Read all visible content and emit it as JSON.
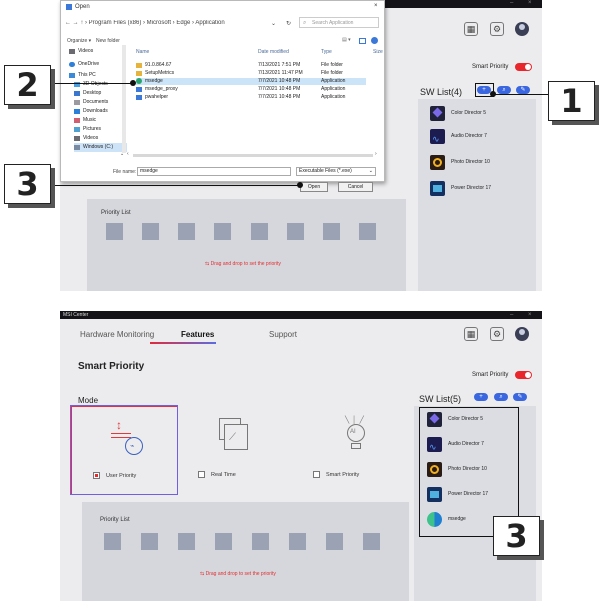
{
  "panel1": {
    "window_controls": {
      "min": "–",
      "close": "×"
    },
    "smart_priority_label": "Smart Priority",
    "sw_list_title": "SW List(4)",
    "apps": [
      "Color Director 5",
      "Audio Director 7",
      "Photo Director 10",
      "Power Director 17"
    ],
    "priority_list_title": "Priority List",
    "drag_hint": "Drag and drop to set the priority",
    "dialog": {
      "title": "Open",
      "path": "← → ↑  ›  Program Files (x86)  ›  Microsoft  ›  Edge  ›  Application",
      "search_placeholder": "Search Application",
      "organize": "Organize ▾",
      "new_folder": "New folder",
      "tree": [
        "Videos",
        "OneDrive",
        "This PC",
        "3D Objects",
        "Desktop",
        "Documents",
        "Downloads",
        "Music",
        "Pictures",
        "Videos",
        "Windows (C:)"
      ],
      "columns": {
        "name": "Name",
        "date": "Date modified",
        "type": "Type",
        "size": "Size"
      },
      "files": [
        {
          "name": "91.0.864.67",
          "date": "7/13/2021 7:51 PM",
          "type": "File folder"
        },
        {
          "name": "SetupMetrics",
          "date": "7/13/2021 11:47 PM",
          "type": "File folder"
        },
        {
          "name": "msedge",
          "date": "7/7/2021 10:48 PM",
          "type": "Application"
        },
        {
          "name": "msedge_proxy",
          "date": "7/7/2021 10:48 PM",
          "type": "Application"
        },
        {
          "name": "pwahelper",
          "date": "7/7/2021 10:48 PM",
          "type": "Application"
        }
      ],
      "file_name_label": "File name:",
      "file_name_value": "msedge",
      "filter": "Executable Files (*.exe)",
      "open": "Open",
      "cancel": "Cancel"
    }
  },
  "callouts": {
    "one": "1",
    "two": "2",
    "three_top": "3",
    "three_bottom": "3"
  },
  "panel2": {
    "app_title": "MSI Center",
    "window_controls": {
      "min": "–",
      "close": "×"
    },
    "tabs": [
      "Hardware Monitoring",
      "Features",
      "Support"
    ],
    "active_tab": "Features",
    "page_title": "Smart Priority",
    "smart_priority_label": "Smart Priority",
    "mode_title": "Mode",
    "modes": [
      "User Priority",
      "Real Time",
      "Smart Priority"
    ],
    "sw_list_title": "SW List(5)",
    "apps": [
      "Color Director 5",
      "Audio Director 7",
      "Photo Director 10",
      "Power Director 17",
      "msedge"
    ],
    "priority_list_title": "Priority List",
    "drag_hint": "Drag and drop to set the priority"
  },
  "colors": {
    "accent_red": "#e8262b",
    "accent_blue": "#3a67e0",
    "tab_underline": "#5b6de0"
  }
}
